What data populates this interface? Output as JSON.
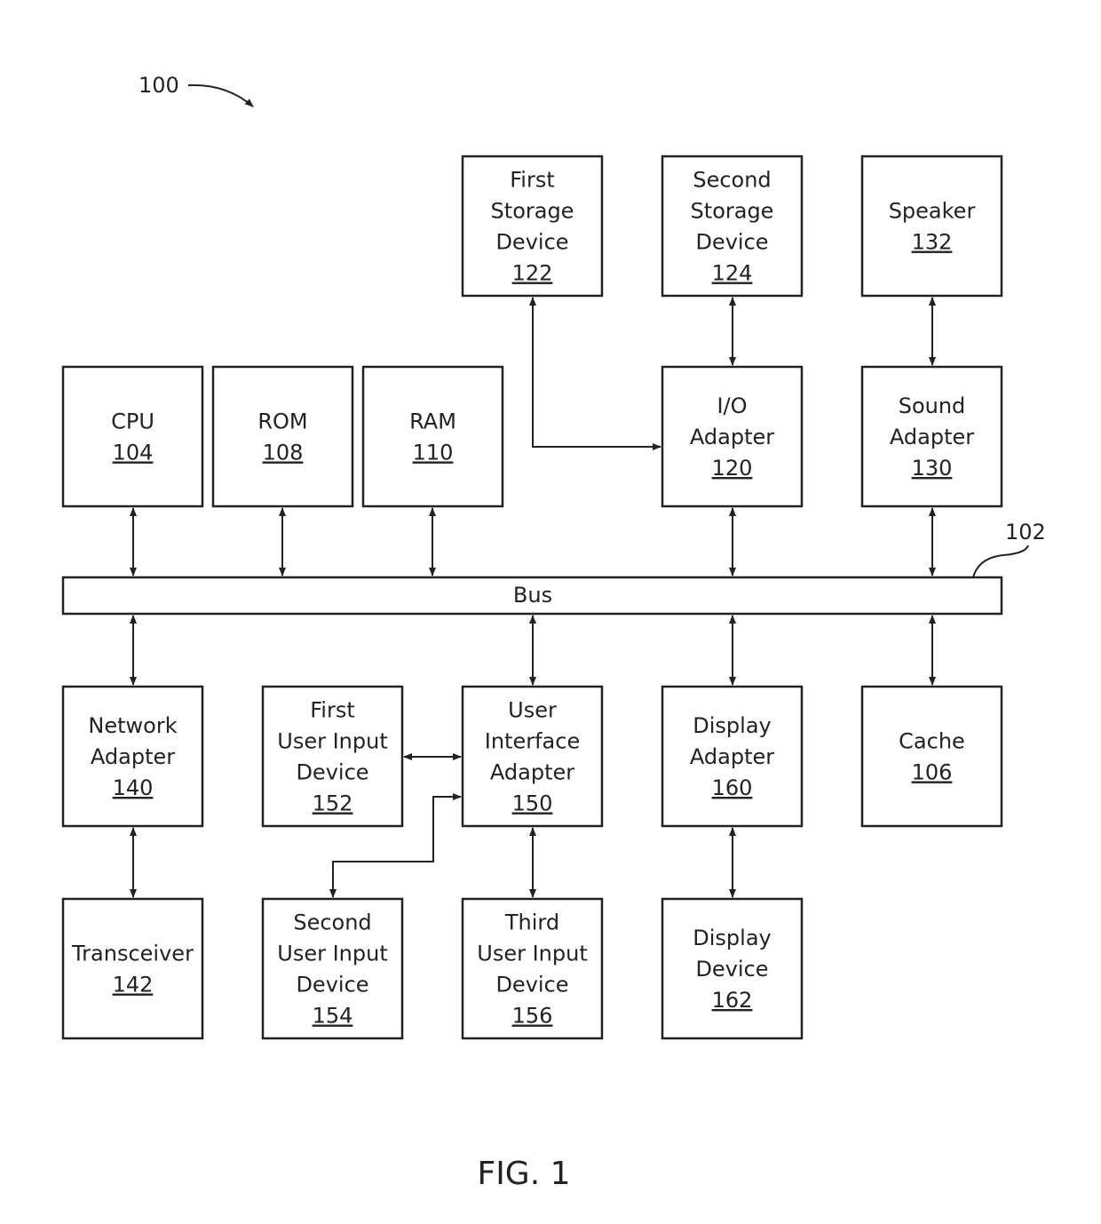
{
  "figure": {
    "ref_number": "100",
    "caption": "FIG. 1",
    "bus": {
      "label": "Bus",
      "ref": "102"
    }
  },
  "blocks": {
    "cpu": {
      "lines": [
        "CPU"
      ],
      "ref": "104"
    },
    "rom": {
      "lines": [
        "ROM"
      ],
      "ref": "108"
    },
    "ram": {
      "lines": [
        "RAM"
      ],
      "ref": "110"
    },
    "io_adapter": {
      "lines": [
        "I/O",
        "Adapter"
      ],
      "ref": "120"
    },
    "sound_adapter": {
      "lines": [
        "Sound",
        "Adapter"
      ],
      "ref": "130"
    },
    "first_storage": {
      "lines": [
        "First",
        "Storage",
        "Device"
      ],
      "ref": "122"
    },
    "second_storage": {
      "lines": [
        "Second",
        "Storage",
        "Device"
      ],
      "ref": "124"
    },
    "speaker": {
      "lines": [
        "Speaker"
      ],
      "ref": "132"
    },
    "network_adapter": {
      "lines": [
        "Network",
        "Adapter"
      ],
      "ref": "140"
    },
    "first_uid": {
      "lines": [
        "First",
        "User Input",
        "Device"
      ],
      "ref": "152"
    },
    "ui_adapter": {
      "lines": [
        "User",
        "Interface",
        "Adapter"
      ],
      "ref": "150"
    },
    "display_adapter": {
      "lines": [
        "Display",
        "Adapter"
      ],
      "ref": "160"
    },
    "cache": {
      "lines": [
        "Cache"
      ],
      "ref": "106"
    },
    "transceiver": {
      "lines": [
        "Transceiver"
      ],
      "ref": "142"
    },
    "second_uid": {
      "lines": [
        "Second",
        "User Input",
        "Device"
      ],
      "ref": "154"
    },
    "third_uid": {
      "lines": [
        "Third",
        "User Input",
        "Device"
      ],
      "ref": "156"
    },
    "display_device": {
      "lines": [
        "Display",
        "Device"
      ],
      "ref": "162"
    }
  }
}
